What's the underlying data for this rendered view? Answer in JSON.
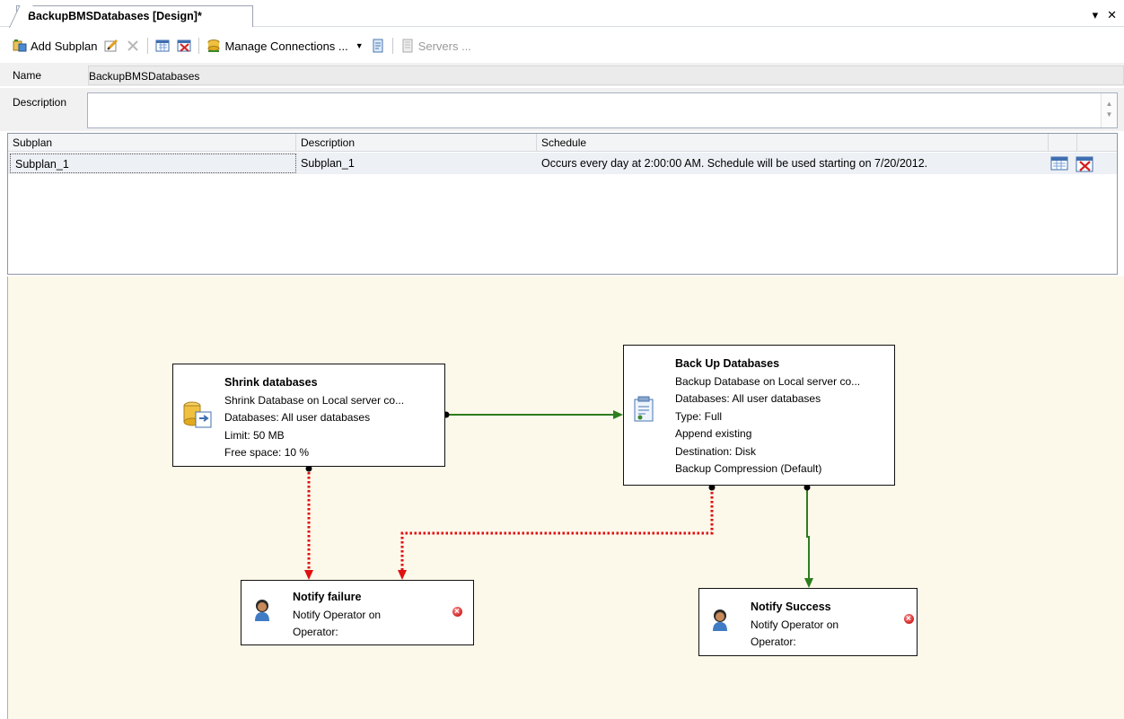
{
  "tab": {
    "title": "BackupBMSDatabases [Design]*",
    "dropdown_glyph": "▾",
    "close_glyph": "✕"
  },
  "toolbar": {
    "add_subplan": "Add Subplan",
    "manage_connections": "Manage Connections ...",
    "servers": "Servers ...",
    "icons": [
      "add-subplan-icon",
      "edit-icon",
      "delete-icon",
      "calendar-icon",
      "remove-schedule-icon",
      "manage-connections-icon",
      "dropdown-arrow-icon",
      "report-icon",
      "servers-icon"
    ]
  },
  "properties": {
    "name_label": "Name",
    "name_value": "BackupBMSDatabases",
    "description_label": "Description",
    "description_value": ""
  },
  "grid": {
    "columns": [
      "Subplan",
      "Description",
      "Schedule"
    ],
    "rows": [
      {
        "subplan": "Subplan_1",
        "description": "Subplan_1",
        "schedule": "Occurs every day at 2:00:00 AM. Schedule will be used starting on 7/20/2012."
      }
    ]
  },
  "tasks": {
    "shrink": {
      "title": "Shrink databases",
      "lines": [
        "Shrink Database on Local server co...",
        "Databases: All user databases",
        "Limit: 50 MB",
        "Free space: 10 %"
      ]
    },
    "backup": {
      "title": "Back Up Databases",
      "lines": [
        "Backup Database on Local server co...",
        "Databases: All user databases",
        "Type: Full",
        "Append existing",
        "Destination: Disk",
        "Backup Compression (Default)"
      ]
    },
    "failure": {
      "title": "Notify failure",
      "lines": [
        "Notify Operator on",
        "Operator:"
      ]
    },
    "success": {
      "title": "Notify Success",
      "lines": [
        "Notify Operator on",
        "Operator:"
      ]
    }
  },
  "colors": {
    "success_link": "#2e7d1f",
    "failure_link": "#e01010",
    "designer_bg": "#fcf8ea"
  }
}
